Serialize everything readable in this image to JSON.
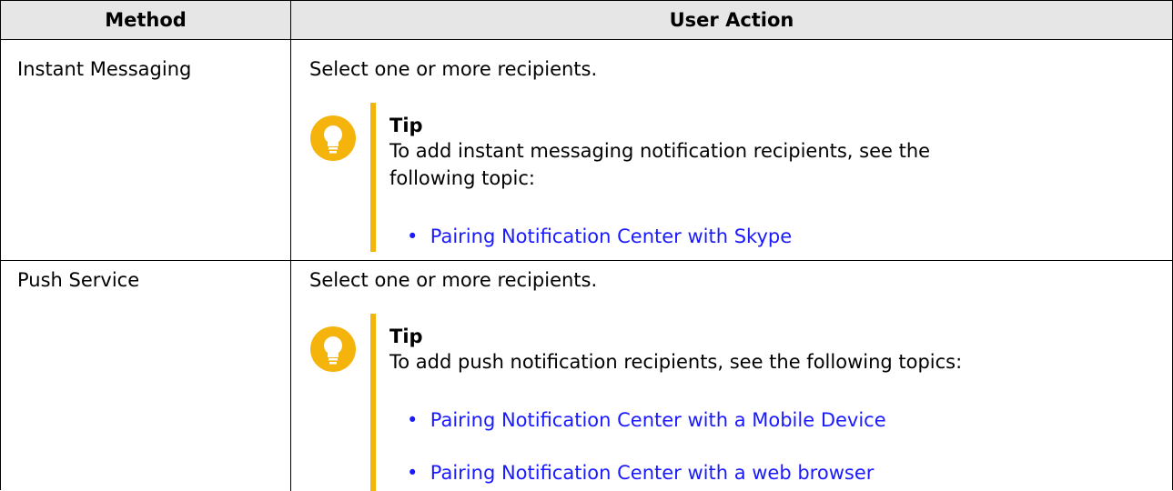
{
  "table": {
    "headers": {
      "method": "Method",
      "user_action": "User Action"
    },
    "rows": [
      {
        "method": "Instant Messaging",
        "action": "Select one or more recipients.",
        "tip": {
          "title": "Tip",
          "body": "To add instant messaging notification recipients, see the following topic:",
          "links": [
            "Pairing Notification Center with Skype"
          ]
        }
      },
      {
        "method": "Push Service",
        "action": "Select one or more recipients.",
        "tip": {
          "title": "Tip",
          "body": "To add push notification recipients, see the following topics:",
          "links": [
            "Pairing Notification Center with a Mobile Device",
            "Pairing Notification Center with a web browser"
          ]
        }
      }
    ]
  },
  "colors": {
    "tip_accent": "#f5b40c",
    "link": "#1a1aff",
    "header_bg": "#e6e6e6"
  },
  "icons": {
    "tip": "lightbulb-icon",
    "bullet": "bullet-dot"
  }
}
